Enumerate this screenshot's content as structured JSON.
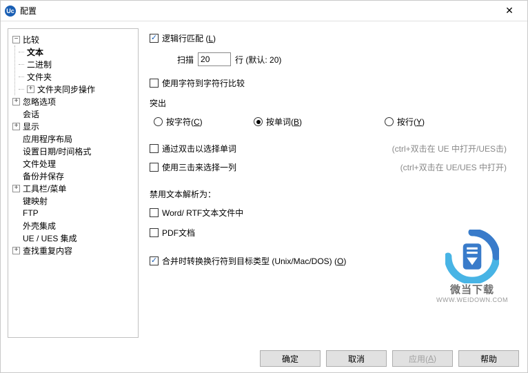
{
  "window": {
    "icon_text": "Uc",
    "title": "配置"
  },
  "tree": {
    "compare": "比较",
    "text": "文本",
    "binary": "二进制",
    "folder": "文件夹",
    "folder_sync": "文件夹同步操作",
    "ignore": "忽略选项",
    "session": "会话",
    "display": "显示",
    "app_layout": "应用程序布局",
    "date_fmt": "设置日期/时间格式",
    "file_handling": "文件处理",
    "backup": "备份并保存",
    "toolbar": "工具栏/菜单",
    "keymap": "键映射",
    "ftp": "FTP",
    "shell": "外壳集成",
    "ue_ues": "UE / UES 集成",
    "find_dup": "查找重复内容"
  },
  "form": {
    "logical_line_match": "逻辑行匹配 (",
    "logical_line_match_key": "L",
    "close_paren": ")",
    "scan_label": "扫描",
    "scan_value": "20",
    "scan_suffix": "行 (默认: 20)",
    "char_by_char": "使用字符到字符行比较",
    "highlight_label": "突出",
    "radio_char": "按字符(",
    "radio_char_key": "C",
    "radio_word": "按单词(",
    "radio_word_key": "B",
    "radio_line": "按行(",
    "radio_line_key": "Y",
    "dbl_click_word": "通过双击以选择单词",
    "dbl_click_hint": "(ctrl+双击在 UE 中打开/UES击)",
    "triple_click": "使用三击来选择一列",
    "triple_click_hint": "(ctrl+双击在 UE/UES 中打开)",
    "disable_parse_label": "禁用文本解析为：",
    "word_rtf": "Word/ RTF文本文件中",
    "pdf": "PDF文档",
    "merge_eol": "合并时转换换行符到目标类型 (Unix/Mac/DOS) (",
    "merge_eol_key": "O"
  },
  "buttons": {
    "ok": "确定",
    "cancel": "取消",
    "apply": "应用(",
    "apply_key": "A",
    "help": "帮助"
  },
  "watermark": {
    "text": "微当下载",
    "url": "WWW.WEIDOWN.COM"
  }
}
